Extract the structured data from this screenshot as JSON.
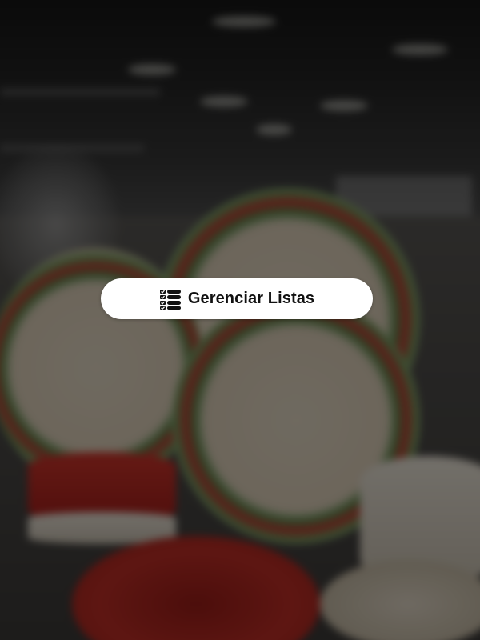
{
  "background": {
    "description_icon": "blurred-dinnerware-photo",
    "overlay_color": "#000000"
  },
  "manage_lists_button": {
    "label": "Gerenciar Listas",
    "icon": "list-checks-icon",
    "background_color": "#ffffff",
    "text_color": "#111111"
  }
}
